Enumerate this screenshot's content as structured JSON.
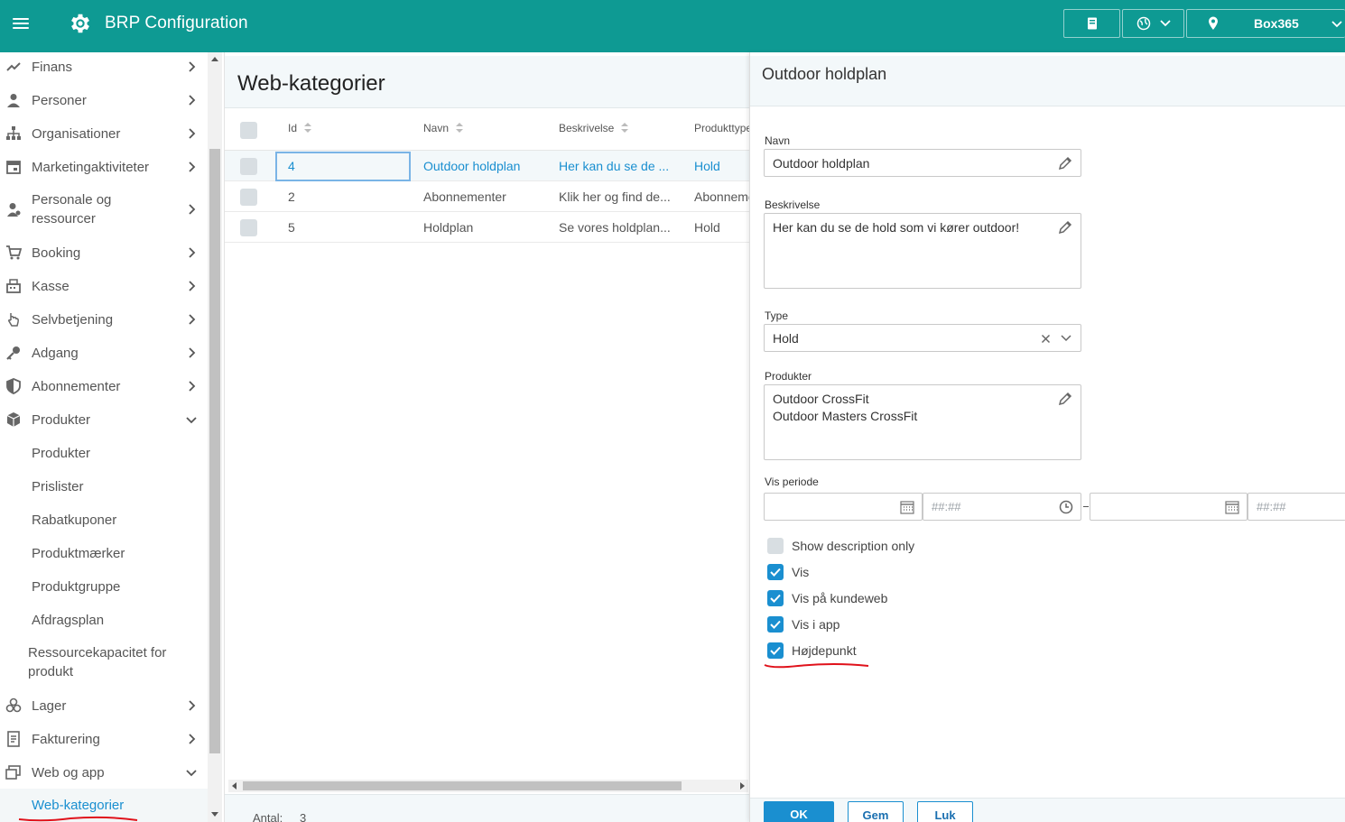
{
  "app": {
    "title": "BRP Configuration"
  },
  "topbar": {
    "location_label": "Box365"
  },
  "sidebar": {
    "items": [
      {
        "label": "Finans",
        "icon": "trend-icon"
      },
      {
        "label": "Personer",
        "icon": "person-icon"
      },
      {
        "label": "Organisationer",
        "icon": "org-icon"
      },
      {
        "label": "Marketingaktiviteter",
        "icon": "calendar-icon"
      },
      {
        "label": "Personale og ressourcer",
        "icon": "staff-icon"
      },
      {
        "label": "Booking",
        "icon": "cart-icon"
      },
      {
        "label": "Kasse",
        "icon": "register-icon"
      },
      {
        "label": "Selvbetjening",
        "icon": "hand-icon"
      },
      {
        "label": "Adgang",
        "icon": "key-icon"
      },
      {
        "label": "Abonnementer",
        "icon": "shield-icon"
      },
      {
        "label": "Produkter",
        "icon": "box-icon"
      },
      {
        "label": "Lager",
        "icon": "boxes-icon"
      },
      {
        "label": "Fakturering",
        "icon": "invoice-icon"
      },
      {
        "label": "Web og app",
        "icon": "window-icon"
      }
    ],
    "produkter_sub": [
      "Produkter",
      "Prislister",
      "Rabatkuponer",
      "Produktmærker",
      "Produktgruppe",
      "Afdragsplan",
      "Ressourcekapacitet for produkt"
    ],
    "web_sub": [
      "Web-kategorier"
    ]
  },
  "main": {
    "title": "Web-kategorier",
    "columns": [
      "Id",
      "Navn",
      "Beskrivelse",
      "Produkttype"
    ],
    "rows": [
      {
        "id": "4",
        "navn": "Outdoor holdplan",
        "beskrivelse": "Her kan du se de ...",
        "type": "Hold"
      },
      {
        "id": "2",
        "navn": "Abonnementer",
        "beskrivelse": "Klik her og find de...",
        "type": "Abonneme"
      },
      {
        "id": "5",
        "navn": "Holdplan",
        "beskrivelse": "Se vores holdplan...",
        "type": "Hold"
      }
    ],
    "count_label": "Antal:",
    "count_value": "3"
  },
  "detail": {
    "title": "Outdoor holdplan",
    "navn_label": "Navn",
    "navn_value": "Outdoor holdplan",
    "beskrivelse_label": "Beskrivelse",
    "beskrivelse_value": "Her kan du se de hold som vi kører outdoor!",
    "type_label": "Type",
    "type_value": "Hold",
    "produkter_label": "Produkter",
    "produkter_values": [
      "Outdoor CrossFit",
      "Outdoor Masters CrossFit"
    ],
    "vis_periode_label": "Vis periode",
    "time_placeholder": "##:##",
    "checkboxes": [
      {
        "label": "Show description only",
        "checked": false
      },
      {
        "label": "Vis",
        "checked": true
      },
      {
        "label": "Vis på kundeweb",
        "checked": true
      },
      {
        "label": "Vis i app",
        "checked": true
      },
      {
        "label": "Højdepunkt",
        "checked": true
      }
    ],
    "buttons": {
      "ok": "OK",
      "gem": "Gem",
      "luk": "Luk"
    }
  },
  "colors": {
    "header": "#0e9a93",
    "accent": "#1a8fd0",
    "annotation": "#e0121b"
  }
}
